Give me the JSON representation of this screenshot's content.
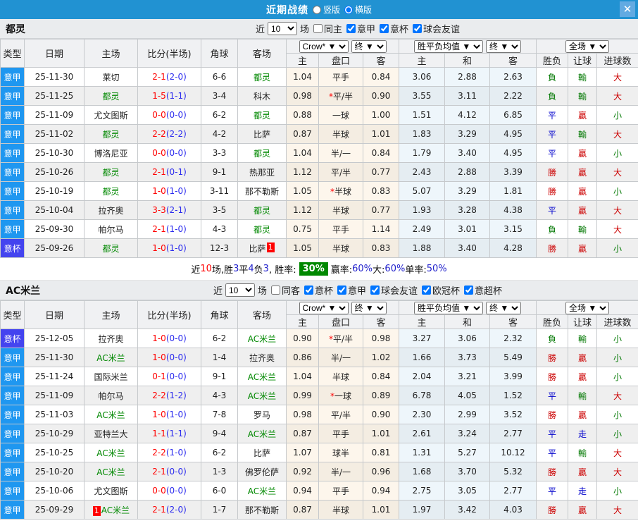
{
  "titlebar": {
    "title": "近期战绩",
    "radios": [
      {
        "label": "竖版",
        "checked": false
      },
      {
        "label": "横版",
        "checked": true
      }
    ],
    "close": "✕"
  },
  "colors": {
    "accent_header": "#2192d2",
    "league_badge": "#1f97f0",
    "cup_badge": "#4444ef",
    "team_green": "#008800",
    "score_fulltime": "#ff0000",
    "score_halftime": "#2b2bee",
    "rate_box": "#008800"
  },
  "result_colors": {
    "勝": "#cc0000",
    "平": "#0000cc",
    "負": "#007700",
    "贏": "#cc0000",
    "輸": "#007700",
    "走": "#0000cc",
    "大": "#cc0000",
    "小": "#007700"
  },
  "table": {
    "cols": {
      "type": "类型",
      "date": "日期",
      "home": "主场",
      "score": "比分(半场)",
      "corner": "角球",
      "away": "客场",
      "h": "主",
      "handicap": "盘口",
      "a": "客",
      "w": "主",
      "d": "和",
      "l": "客",
      "wdl": "胜负",
      "letball": "让球",
      "goals": "进球数"
    }
  },
  "sections": [
    {
      "team": "都灵",
      "filters": {
        "prefix": "近",
        "count": "10",
        "suffix": "场",
        "checkboxes": [
          {
            "label": "同主",
            "checked": false
          },
          {
            "label": "意甲",
            "checked": true
          },
          {
            "label": "意杯",
            "checked": true
          },
          {
            "label": "球会友谊",
            "checked": true
          }
        ]
      },
      "dropdowns": {
        "company": "Crow*",
        "company_state": "终",
        "wdl": "胜平负均值",
        "wdl_state": "终",
        "scope": "全场"
      },
      "rows": [
        {
          "type": "意甲",
          "cup": false,
          "date": "25-11-30",
          "home": "莱切",
          "hg": false,
          "hb": "",
          "ft": "2-1",
          "ht": "(2-0)",
          "corner": "6-6",
          "away": "都灵",
          "ag": true,
          "ab": "",
          "o1": "1.04",
          "handicap": "平手",
          "star": false,
          "o2": "0.84",
          "w": "3.06",
          "d": "2.88",
          "l": "2.63",
          "r1": "負",
          "r2": "輸",
          "r3": "大"
        },
        {
          "type": "意甲",
          "cup": false,
          "date": "25-11-25",
          "home": "都灵",
          "hg": true,
          "hb": "",
          "ft": "1-5",
          "ht": "(1-1)",
          "corner": "3-4",
          "away": "科木",
          "ag": false,
          "ab": "",
          "o1": "0.98",
          "handicap": "平/半",
          "star": true,
          "o2": "0.90",
          "w": "3.55",
          "d": "3.11",
          "l": "2.22",
          "r1": "負",
          "r2": "輸",
          "r3": "大"
        },
        {
          "type": "意甲",
          "cup": false,
          "date": "25-11-09",
          "home": "尤文图斯",
          "hg": false,
          "hb": "",
          "ft": "0-0",
          "ht": "(0-0)",
          "corner": "6-2",
          "away": "都灵",
          "ag": true,
          "ab": "",
          "o1": "0.88",
          "handicap": "一球",
          "star": false,
          "o2": "1.00",
          "w": "1.51",
          "d": "4.12",
          "l": "6.85",
          "r1": "平",
          "r2": "贏",
          "r3": "小"
        },
        {
          "type": "意甲",
          "cup": false,
          "date": "25-11-02",
          "home": "都灵",
          "hg": true,
          "hb": "",
          "ft": "2-2",
          "ht": "(2-2)",
          "corner": "4-2",
          "away": "比萨",
          "ag": false,
          "ab": "",
          "o1": "0.87",
          "handicap": "半球",
          "star": false,
          "o2": "1.01",
          "w": "1.83",
          "d": "3.29",
          "l": "4.95",
          "r1": "平",
          "r2": "輸",
          "r3": "大"
        },
        {
          "type": "意甲",
          "cup": false,
          "date": "25-10-30",
          "home": "博洛尼亚",
          "hg": false,
          "hb": "",
          "ft": "0-0",
          "ht": "(0-0)",
          "corner": "3-3",
          "away": "都灵",
          "ag": true,
          "ab": "",
          "o1": "1.04",
          "handicap": "半/一",
          "star": false,
          "o2": "0.84",
          "w": "1.79",
          "d": "3.40",
          "l": "4.95",
          "r1": "平",
          "r2": "贏",
          "r3": "小"
        },
        {
          "type": "意甲",
          "cup": false,
          "date": "25-10-26",
          "home": "都灵",
          "hg": true,
          "hb": "",
          "ft": "2-1",
          "ht": "(0-1)",
          "corner": "9-1",
          "away": "热那亚",
          "ag": false,
          "ab": "",
          "o1": "1.12",
          "handicap": "平/半",
          "star": false,
          "o2": "0.77",
          "w": "2.43",
          "d": "2.88",
          "l": "3.39",
          "r1": "勝",
          "r2": "贏",
          "r3": "大"
        },
        {
          "type": "意甲",
          "cup": false,
          "date": "25-10-19",
          "home": "都灵",
          "hg": true,
          "hb": "",
          "ft": "1-0",
          "ht": "(1-0)",
          "corner": "3-11",
          "away": "那不勒斯",
          "ag": false,
          "ab": "",
          "o1": "1.05",
          "handicap": "半球",
          "star": true,
          "o2": "0.83",
          "w": "5.07",
          "d": "3.29",
          "l": "1.81",
          "r1": "勝",
          "r2": "贏",
          "r3": "小"
        },
        {
          "type": "意甲",
          "cup": false,
          "date": "25-10-04",
          "home": "拉齐奥",
          "hg": false,
          "hb": "",
          "ft": "3-3",
          "ht": "(2-1)",
          "corner": "3-5",
          "away": "都灵",
          "ag": true,
          "ab": "",
          "o1": "1.12",
          "handicap": "半球",
          "star": false,
          "o2": "0.77",
          "w": "1.93",
          "d": "3.28",
          "l": "4.38",
          "r1": "平",
          "r2": "贏",
          "r3": "大"
        },
        {
          "type": "意甲",
          "cup": false,
          "date": "25-09-30",
          "home": "帕尔马",
          "hg": false,
          "hb": "",
          "ft": "2-1",
          "ht": "(1-0)",
          "corner": "4-3",
          "away": "都灵",
          "ag": true,
          "ab": "",
          "o1": "0.75",
          "handicap": "平手",
          "star": false,
          "o2": "1.14",
          "w": "2.49",
          "d": "3.01",
          "l": "3.15",
          "r1": "負",
          "r2": "輸",
          "r3": "大"
        },
        {
          "type": "意杯",
          "cup": true,
          "date": "25-09-26",
          "home": "都灵",
          "hg": true,
          "hb": "",
          "ft": "1-0",
          "ht": "(1-0)",
          "corner": "12-3",
          "away": "比萨",
          "ag": false,
          "ab": "1",
          "o1": "1.05",
          "handicap": "半球",
          "star": false,
          "o2": "0.83",
          "w": "1.88",
          "d": "3.40",
          "l": "4.28",
          "r1": "勝",
          "r2": "贏",
          "r3": "小"
        }
      ],
      "summary": [
        {
          "t": "近"
        },
        {
          "t": "10",
          "c": "red"
        },
        {
          "t": "场,胜"
        },
        {
          "t": "3",
          "c": "blue"
        },
        {
          "t": "平"
        },
        {
          "t": "4",
          "c": "blue"
        },
        {
          "t": "负"
        },
        {
          "t": "3",
          "c": "blue"
        },
        {
          "t": ", 胜率: "
        },
        {
          "t": "30%",
          "box": true
        },
        {
          "t": " 赢率:"
        },
        {
          "t": "60%",
          "c": "blue"
        },
        {
          "t": " 大:"
        },
        {
          "t": "60%",
          "c": "blue"
        },
        {
          "t": " 单率:"
        },
        {
          "t": "50%",
          "c": "blue"
        }
      ]
    },
    {
      "team": "AC米兰",
      "filters": {
        "prefix": "近",
        "count": "10",
        "suffix": "场",
        "checkboxes": [
          {
            "label": "同客",
            "checked": false
          },
          {
            "label": "意杯",
            "checked": true
          },
          {
            "label": "意甲",
            "checked": true
          },
          {
            "label": "球会友谊",
            "checked": true
          },
          {
            "label": "欧冠杯",
            "checked": true
          },
          {
            "label": "意超杯",
            "checked": true
          }
        ]
      },
      "dropdowns": {
        "company": "Crow*",
        "company_state": "终",
        "wdl": "胜平负均值",
        "wdl_state": "终",
        "scope": "全场"
      },
      "rows": [
        {
          "type": "意杯",
          "cup": true,
          "date": "25-12-05",
          "home": "拉齐奥",
          "hg": false,
          "hb": "",
          "ft": "1-0",
          "ht": "(0-0)",
          "corner": "6-2",
          "away": "AC米兰",
          "ag": true,
          "ab": "",
          "o1": "0.90",
          "handicap": "平/半",
          "star": true,
          "o2": "0.98",
          "w": "3.27",
          "d": "3.06",
          "l": "2.32",
          "r1": "負",
          "r2": "輸",
          "r3": "小"
        },
        {
          "type": "意甲",
          "cup": false,
          "date": "25-11-30",
          "home": "AC米兰",
          "hg": true,
          "hb": "",
          "ft": "1-0",
          "ht": "(0-0)",
          "corner": "1-4",
          "away": "拉齐奥",
          "ag": false,
          "ab": "",
          "o1": "0.86",
          "handicap": "半/一",
          "star": false,
          "o2": "1.02",
          "w": "1.66",
          "d": "3.73",
          "l": "5.49",
          "r1": "勝",
          "r2": "贏",
          "r3": "小"
        },
        {
          "type": "意甲",
          "cup": false,
          "date": "25-11-24",
          "home": "国际米兰",
          "hg": false,
          "hb": "",
          "ft": "0-1",
          "ht": "(0-0)",
          "corner": "9-1",
          "away": "AC米兰",
          "ag": true,
          "ab": "",
          "o1": "1.04",
          "handicap": "半球",
          "star": false,
          "o2": "0.84",
          "w": "2.04",
          "d": "3.21",
          "l": "3.99",
          "r1": "勝",
          "r2": "贏",
          "r3": "小"
        },
        {
          "type": "意甲",
          "cup": false,
          "date": "25-11-09",
          "home": "帕尔马",
          "hg": false,
          "hb": "",
          "ft": "2-2",
          "ht": "(1-2)",
          "corner": "4-3",
          "away": "AC米兰",
          "ag": true,
          "ab": "",
          "o1": "0.99",
          "handicap": "一球",
          "star": true,
          "o2": "0.89",
          "w": "6.78",
          "d": "4.05",
          "l": "1.52",
          "r1": "平",
          "r2": "輸",
          "r3": "大"
        },
        {
          "type": "意甲",
          "cup": false,
          "date": "25-11-03",
          "home": "AC米兰",
          "hg": true,
          "hb": "",
          "ft": "1-0",
          "ht": "(1-0)",
          "corner": "7-8",
          "away": "罗马",
          "ag": false,
          "ab": "",
          "o1": "0.98",
          "handicap": "平/半",
          "star": false,
          "o2": "0.90",
          "w": "2.30",
          "d": "2.99",
          "l": "3.52",
          "r1": "勝",
          "r2": "贏",
          "r3": "小"
        },
        {
          "type": "意甲",
          "cup": false,
          "date": "25-10-29",
          "home": "亚特兰大",
          "hg": false,
          "hb": "",
          "ft": "1-1",
          "ht": "(1-1)",
          "corner": "9-4",
          "away": "AC米兰",
          "ag": true,
          "ab": "",
          "o1": "0.87",
          "handicap": "平手",
          "star": false,
          "o2": "1.01",
          "w": "2.61",
          "d": "3.24",
          "l": "2.77",
          "r1": "平",
          "r2": "走",
          "r3": "小"
        },
        {
          "type": "意甲",
          "cup": false,
          "date": "25-10-25",
          "home": "AC米兰",
          "hg": true,
          "hb": "",
          "ft": "2-2",
          "ht": "(1-0)",
          "corner": "6-2",
          "away": "比萨",
          "ag": false,
          "ab": "",
          "o1": "1.07",
          "handicap": "球半",
          "star": false,
          "o2": "0.81",
          "w": "1.31",
          "d": "5.27",
          "l": "10.12",
          "r1": "平",
          "r2": "輸",
          "r3": "大"
        },
        {
          "type": "意甲",
          "cup": false,
          "date": "25-10-20",
          "home": "AC米兰",
          "hg": true,
          "hb": "",
          "ft": "2-1",
          "ht": "(0-0)",
          "corner": "1-3",
          "away": "佛罗伦萨",
          "ag": false,
          "ab": "",
          "o1": "0.92",
          "handicap": "半/一",
          "star": false,
          "o2": "0.96",
          "w": "1.68",
          "d": "3.70",
          "l": "5.32",
          "r1": "勝",
          "r2": "贏",
          "r3": "大"
        },
        {
          "type": "意甲",
          "cup": false,
          "date": "25-10-06",
          "home": "尤文图斯",
          "hg": false,
          "hb": "",
          "ft": "0-0",
          "ht": "(0-0)",
          "corner": "6-0",
          "away": "AC米兰",
          "ag": true,
          "ab": "",
          "o1": "0.94",
          "handicap": "平手",
          "star": false,
          "o2": "0.94",
          "w": "2.75",
          "d": "3.05",
          "l": "2.77",
          "r1": "平",
          "r2": "走",
          "r3": "小"
        },
        {
          "type": "意甲",
          "cup": false,
          "date": "25-09-29",
          "home": "AC米兰",
          "hg": true,
          "hb": "1",
          "ft": "2-1",
          "ht": "(2-0)",
          "corner": "1-7",
          "away": "那不勒斯",
          "ag": false,
          "ab": "",
          "o1": "0.87",
          "handicap": "半球",
          "star": false,
          "o2": "1.01",
          "w": "1.97",
          "d": "3.42",
          "l": "4.03",
          "r1": "勝",
          "r2": "贏",
          "r3": "大"
        }
      ],
      "summary": null
    }
  ]
}
